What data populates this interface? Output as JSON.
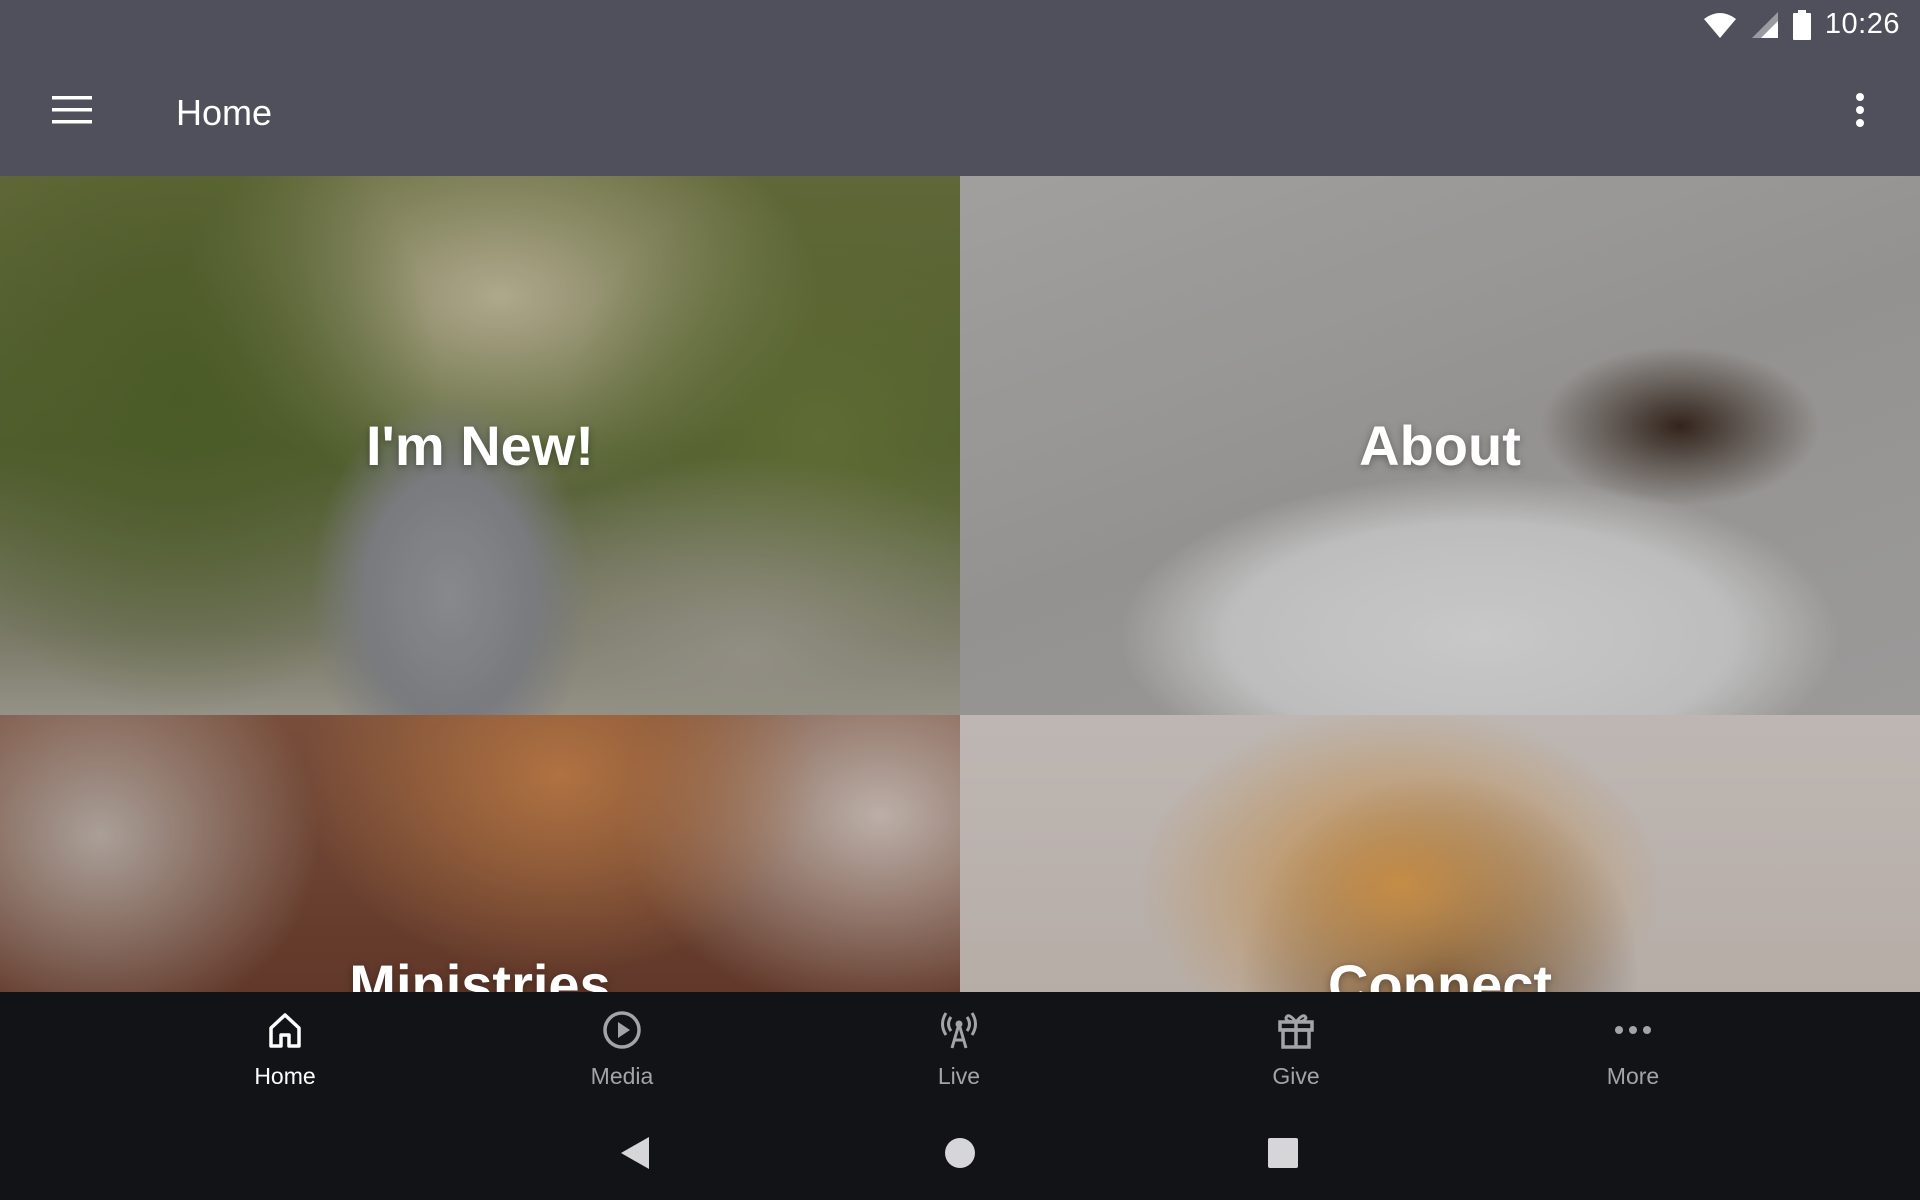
{
  "status_bar": {
    "time": "10:26",
    "icons": [
      "wifi-icon",
      "cell-signal-icon",
      "battery-icon"
    ]
  },
  "app_bar": {
    "title": "Home",
    "menu_icon": "hamburger-menu-icon",
    "overflow_icon": "more-vert-icon"
  },
  "tiles": [
    {
      "label": "I'm New!"
    },
    {
      "label": "About"
    },
    {
      "label": "Ministries"
    },
    {
      "label": "Connect"
    }
  ],
  "bottom_nav": {
    "items": [
      {
        "label": "Home",
        "icon": "home-icon",
        "active": true
      },
      {
        "label": "Media",
        "icon": "play-circle-icon",
        "active": false
      },
      {
        "label": "Live",
        "icon": "broadcast-tower-icon",
        "active": false
      },
      {
        "label": "Give",
        "icon": "gift-icon",
        "active": false
      },
      {
        "label": "More",
        "icon": "more-horiz-icon",
        "active": false
      }
    ]
  },
  "system_nav": {
    "buttons": [
      "back-icon",
      "home-circle-icon",
      "recents-square-icon"
    ]
  },
  "colors": {
    "app_bar": "#4f505b",
    "nav_background": "#121316",
    "nav_active": "#ffffff",
    "nav_inactive": "#a3a4a8"
  }
}
